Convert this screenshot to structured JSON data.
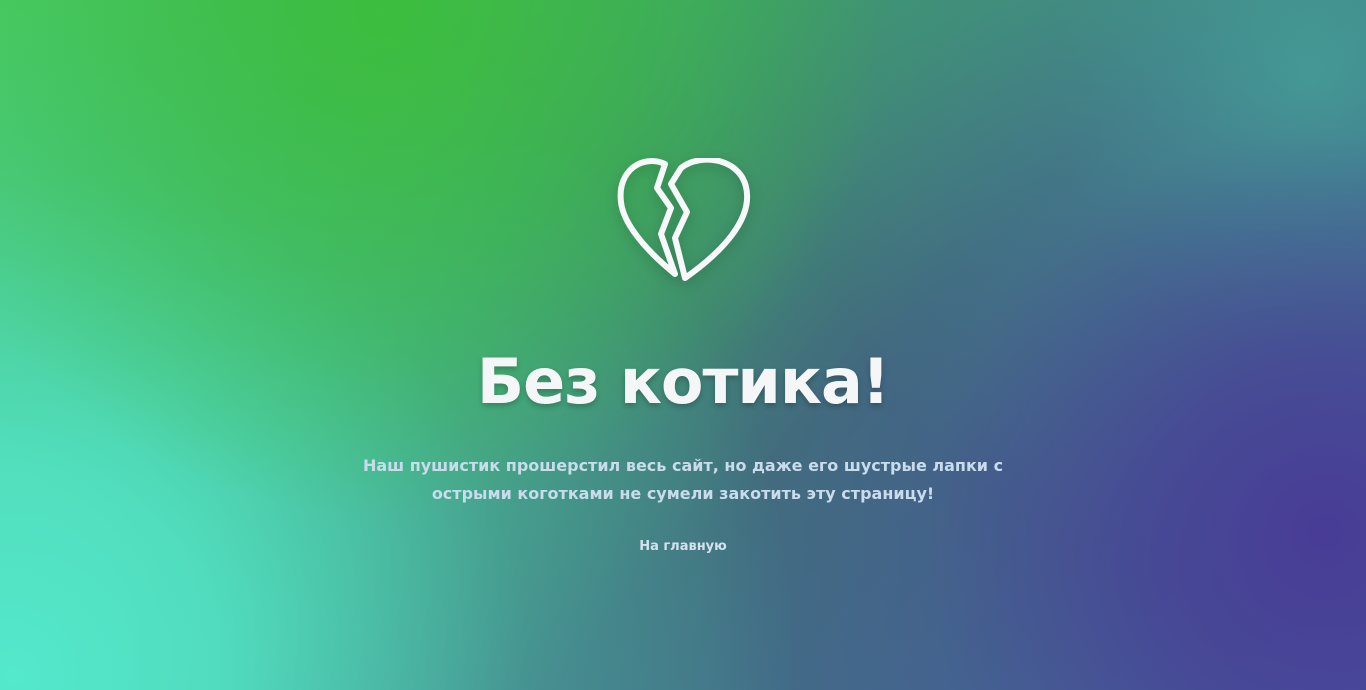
{
  "page": {
    "title": "Без котика!",
    "description": "Наш пушистик прошерстил весь сайт, но даже его шустрые лапки с острыми коготками не сумели закотить эту страницу!",
    "home_link": "На главную",
    "icon": "broken-heart-icon"
  },
  "colors": {
    "text": "#f4f6f7",
    "description_text": "#c9dcec",
    "gradient_green": "#3cbe3c",
    "gradient_teal": "#54e8cc",
    "gradient_purple": "#483c96"
  }
}
